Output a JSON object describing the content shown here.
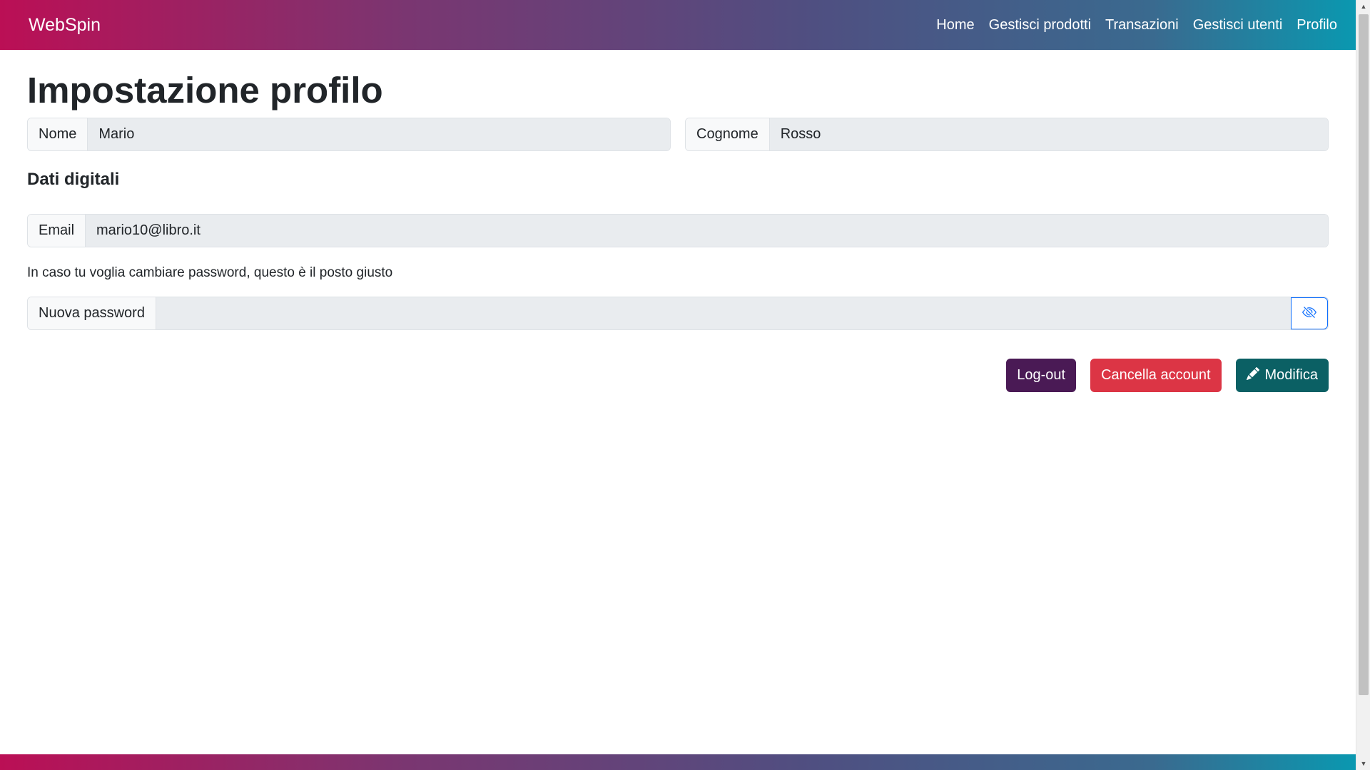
{
  "navbar": {
    "brand": "WebSpin",
    "links": [
      "Home",
      "Gestisci prodotti",
      "Transazioni",
      "Gestisci utenti",
      "Profilo"
    ],
    "gradient_colors": [
      "#bb0f55",
      "#7a3671",
      "#4f4f81",
      "#0a98b0"
    ]
  },
  "page": {
    "title": "Impostazione profilo"
  },
  "name_fields": {
    "first_name_label": "Nome",
    "first_name_value": "Mario",
    "last_name_label": "Cognome",
    "last_name_value": "Rosso"
  },
  "digital": {
    "section_title": "Dati digitali",
    "email_label": "Email",
    "email_value": "mario10@libro.it",
    "hint": "In caso tu voglia cambiare password, questo è il posto giusto",
    "password_label": "Nuova password",
    "password_value": "",
    "toggle_icon": "eye-slash-icon"
  },
  "actions": {
    "logout_label": "Log-out",
    "delete_label": "Cancella account",
    "edit_label": "Modifica",
    "edit_icon": "pencil-icon",
    "colors": {
      "logout": "#4a1a55",
      "delete": "#dc3545",
      "edit": "#0b6064"
    }
  }
}
